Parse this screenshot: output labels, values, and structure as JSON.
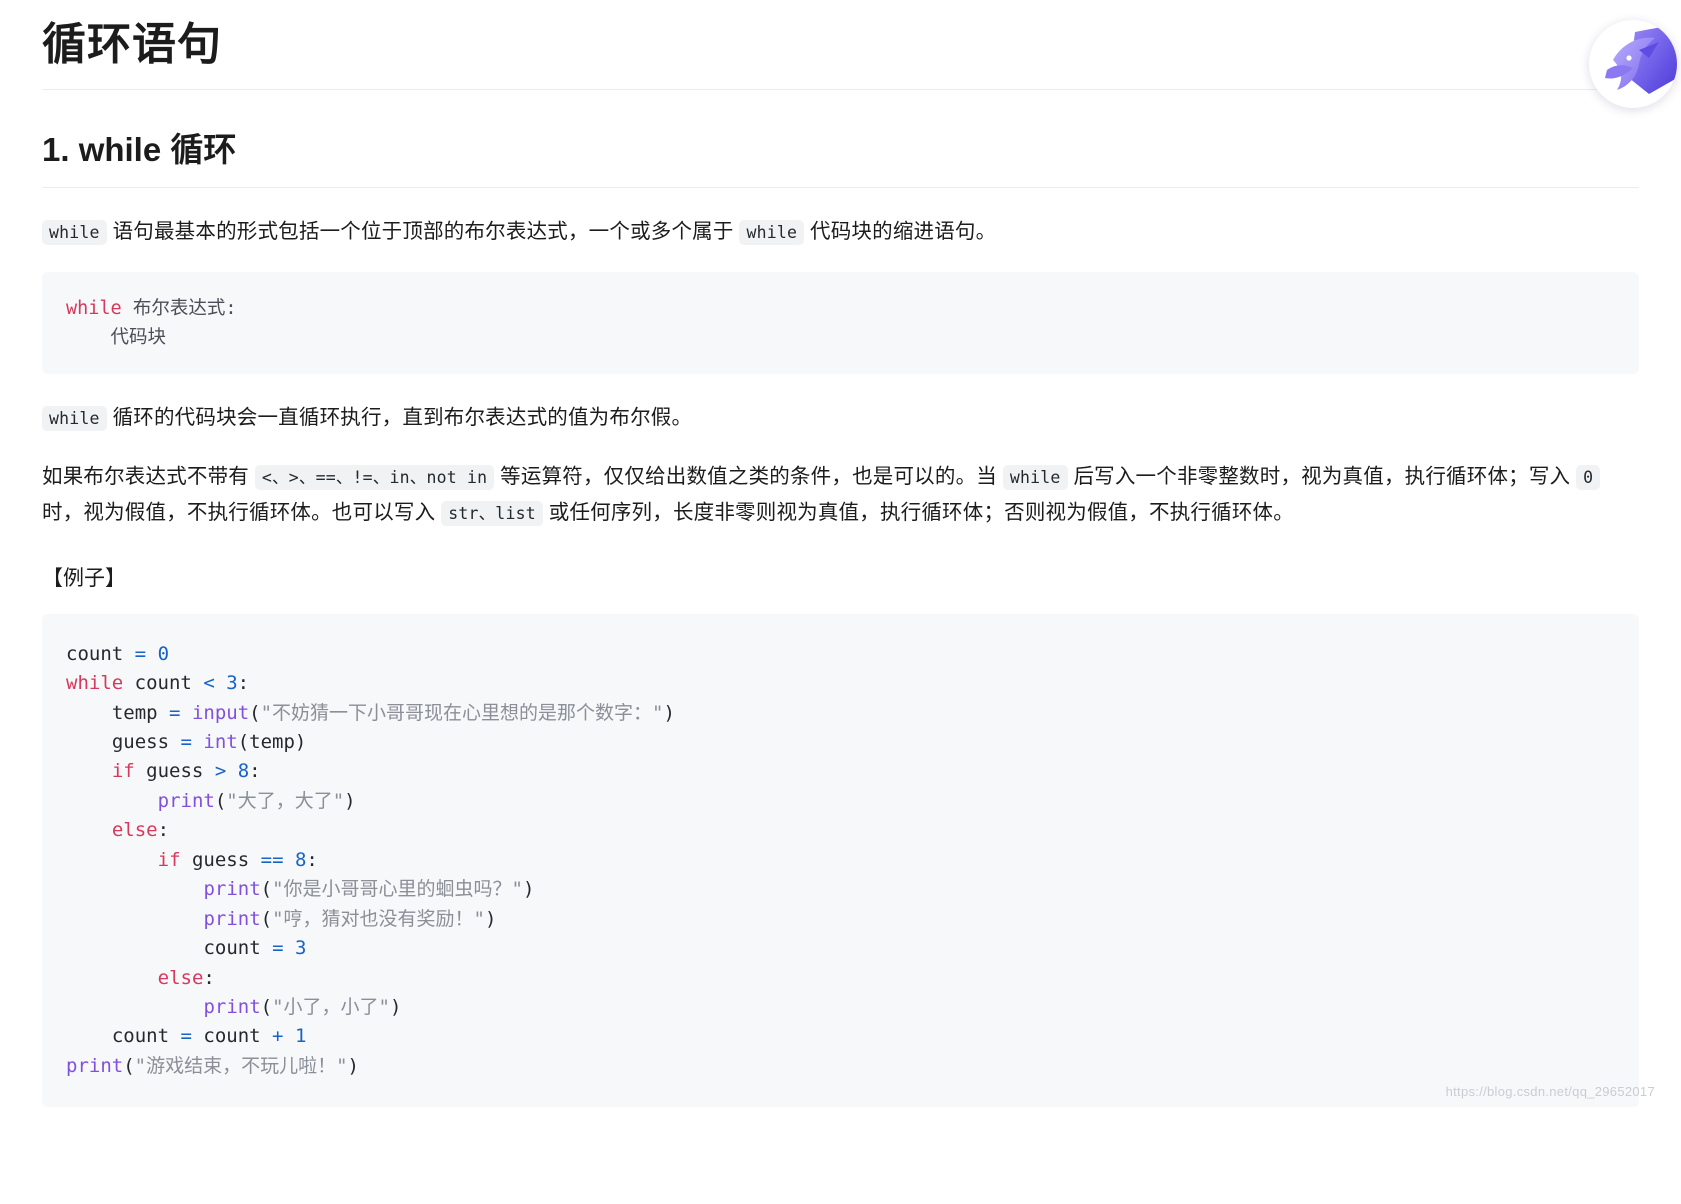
{
  "document": {
    "title": "循环语句",
    "section_heading": "1. while 循环",
    "example_label": "【例子】"
  },
  "logo": {
    "icon_name": "hummingbird-logo",
    "gradient_start": "#8b7bf0",
    "gradient_end": "#5b4de0"
  },
  "paragraphs": {
    "p1": {
      "code1": "while",
      "text1": " 语句最基本的形式包括一个位于顶部的布尔表达式，一个或多个属于 ",
      "code2": "while",
      "text2": " 代码块的缩进语句。"
    },
    "p2": {
      "code1": "while",
      "text1": " 循环的代码块会一直循环执行，直到布尔表达式的值为布尔假。"
    },
    "p3": {
      "text1": "如果布尔表达式不带有 ",
      "code1": "<、>、==、!=、in、not in",
      "text2": " 等运算符，仅仅给出数值之类的条件，也是可以的。当 ",
      "code2": "while",
      "text3": " 后写入一个非零整数时，视为真值，执行循环体；写入 ",
      "code3": "0",
      "text4": " 时，视为假值，不执行循环体。也可以写入 ",
      "code4": "str、list",
      "text5": " 或任何序列，长度非零则视为真值，执行循环体；否则视为假值，不执行循环体。"
    }
  },
  "code_blocks": {
    "syntax": {
      "keyword": "while",
      "expr": " 布尔表达式:",
      "body": "    代码块"
    },
    "example": {
      "lines": [
        "count = 0",
        "while count < 3:",
        "    temp = input(\"不妨猜一下小哥哥现在心里想的是那个数字：\")",
        "    guess = int(temp)",
        "    if guess > 8:",
        "        print(\"大了，大了\")",
        "    else:",
        "        if guess == 8:",
        "            print(\"你是小哥哥心里的蛔虫吗？\")",
        "            print(\"哼，猜对也没有奖励！\")",
        "            count = 3",
        "        else:",
        "            print(\"小了，小了\")",
        "    count = count + 1",
        "print(\"游戏结束，不玩儿啦！\")"
      ]
    }
  },
  "watermark": {
    "text": "https://blog.csdn.net/qq_29652017"
  }
}
